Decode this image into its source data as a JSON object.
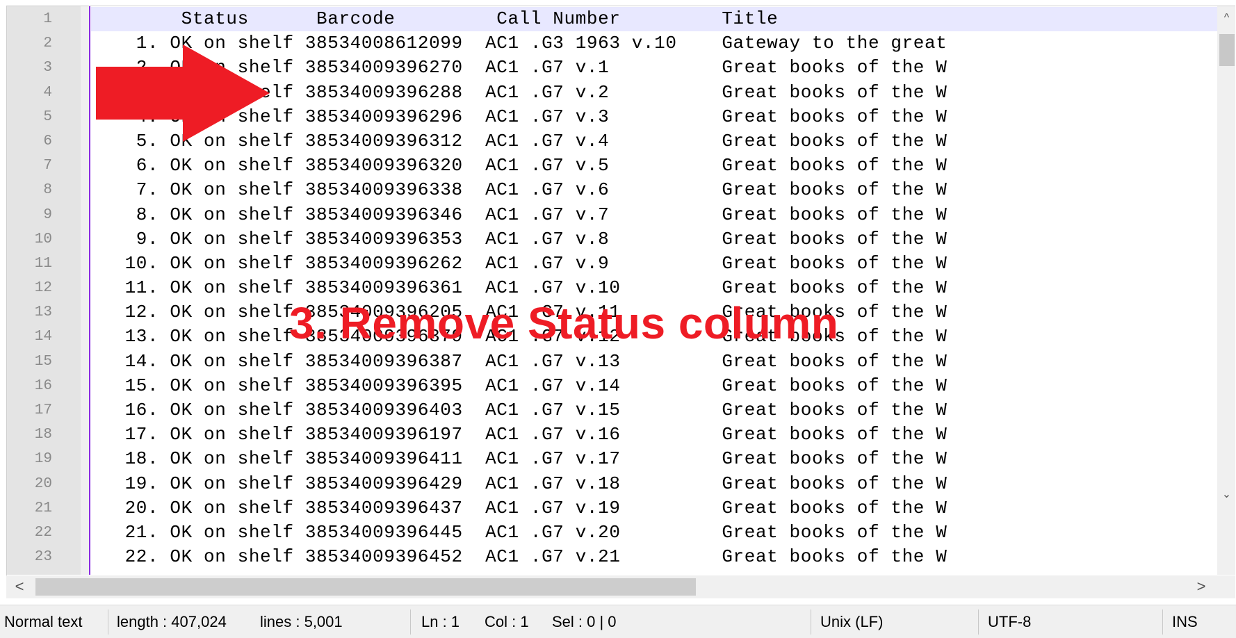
{
  "editor": {
    "line_numbers": [
      "1",
      "2",
      "3",
      "4",
      "5",
      "6",
      "7",
      "8",
      "9",
      "10",
      "11",
      "12",
      "13",
      "14",
      "15",
      "16",
      "17",
      "18",
      "19",
      "20",
      "21",
      "22",
      "23"
    ],
    "lines": [
      "        Status      Barcode         Call Number         Title",
      "    1. OK on shelf 38534008612099  AC1 .G3 1963 v.10    Gateway to the great",
      "    2. OK on shelf 38534009396270  AC1 .G7 v.1          Great books of the W",
      "    3. OK on shelf 38534009396288  AC1 .G7 v.2          Great books of the W",
      "    4. OK on shelf 38534009396296  AC1 .G7 v.3          Great books of the W",
      "    5. OK on shelf 38534009396312  AC1 .G7 v.4          Great books of the W",
      "    6. OK on shelf 38534009396320  AC1 .G7 v.5          Great books of the W",
      "    7. OK on shelf 38534009396338  AC1 .G7 v.6          Great books of the W",
      "    8. OK on shelf 38534009396346  AC1 .G7 v.7          Great books of the W",
      "    9. OK on shelf 38534009396353  AC1 .G7 v.8          Great books of the W",
      "   10. OK on shelf 38534009396262  AC1 .G7 v.9          Great books of the W",
      "   11. OK on shelf 38534009396361  AC1 .G7 v.10         Great books of the W",
      "   12. OK on shelf 38534009396205  AC1 .G7 v.11         Great books of the W",
      "   13. OK on shelf 38534009396379  AC1 .G7 v.12         Great books of the W",
      "   14. OK on shelf 38534009396387  AC1 .G7 v.13         Great books of the W",
      "   15. OK on shelf 38534009396395  AC1 .G7 v.14         Great books of the W",
      "   16. OK on shelf 38534009396403  AC1 .G7 v.15         Great books of the W",
      "   17. OK on shelf 38534009396197  AC1 .G7 v.16         Great books of the W",
      "   18. OK on shelf 38534009396411  AC1 .G7 v.17         Great books of the W",
      "   19. OK on shelf 38534009396429  AC1 .G7 v.18         Great books of the W",
      "   20. OK on shelf 38534009396437  AC1 .G7 v.19         Great books of the W",
      "   21. OK on shelf 38534009396445  AC1 .G7 v.20         Great books of the W",
      "   22. OK on shelf 38534009396452  AC1 .G7 v.21         Great books of the W"
    ]
  },
  "scrollbars": {
    "up_icon": "chevron-up-icon",
    "down_icon": "chevron-down-icon",
    "left_icon": "chevron-left-icon",
    "right_icon": "chevron-right-icon",
    "up_glyph": "^",
    "down_glyph": "⌄",
    "left_glyph": "<",
    "right_glyph": ">"
  },
  "statusbar": {
    "doc_type": "Normal text",
    "length": "length : 407,024",
    "lines": "lines : 5,001",
    "ln": "Ln : 1",
    "col": "Col : 1",
    "sel": "Sel : 0 | 0",
    "eol": "Unix (LF)",
    "encoding": "UTF-8",
    "mode": "INS"
  },
  "annotation": {
    "text": "3. Remove Status column",
    "color": "#ee1c25",
    "arrow_icon": "red-arrow-icon"
  }
}
